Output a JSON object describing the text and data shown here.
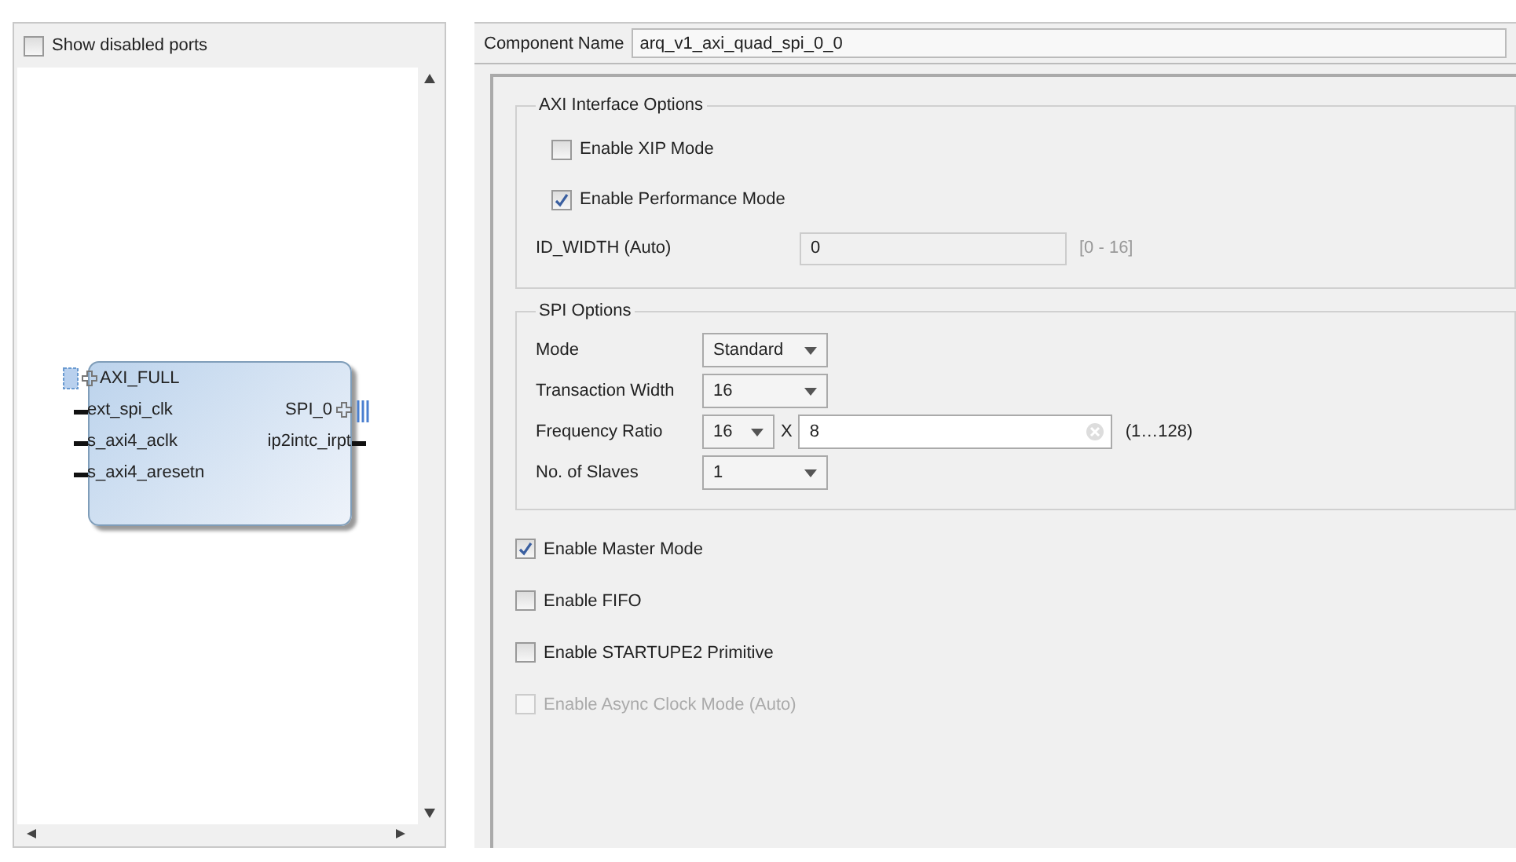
{
  "left_panel": {
    "show_disabled_ports": {
      "label": "Show disabled ports",
      "checked": false
    },
    "block": {
      "bus_port": "AXI_FULL",
      "left_ports": [
        "ext_spi_clk",
        "s_axi4_aclk",
        "s_axi4_aresetn"
      ],
      "right_ports": [
        {
          "label": "SPI_0",
          "kind": "bus"
        },
        {
          "label": "ip2intc_irpt",
          "kind": "wire"
        }
      ]
    }
  },
  "component_name": {
    "label": "Component Name",
    "value": "arq_v1_axi_quad_spi_0_0"
  },
  "axi_options": {
    "title": "AXI Interface Options",
    "checkboxes": [
      {
        "label": "Enable XIP Mode",
        "checked": false,
        "disabled": false
      },
      {
        "label": "Enable Performance Mode",
        "checked": true,
        "disabled": false
      }
    ],
    "id_width": {
      "label": "ID_WIDTH (Auto)",
      "value": "0",
      "range": "[0 - 16]",
      "disabled": true
    }
  },
  "spi_options": {
    "title": "SPI Options",
    "rows": [
      {
        "kind": "select",
        "label": "Mode",
        "value": "Standard"
      },
      {
        "kind": "select",
        "label": "Transaction Width",
        "value": "16"
      },
      {
        "kind": "ratio",
        "label": "Frequency Ratio",
        "value": "16",
        "multiplier": "X",
        "factor": "8",
        "range": "(1…128)"
      },
      {
        "kind": "select",
        "label": "No. of Slaves",
        "value": "1"
      }
    ]
  },
  "options": [
    {
      "label": "Enable Master Mode",
      "checked": true,
      "disabled": false
    },
    {
      "label": "Enable FIFO",
      "checked": false,
      "disabled": false
    },
    {
      "label": "Enable STARTUPE2 Primitive",
      "checked": false,
      "disabled": false
    },
    {
      "label": "Enable Async Clock Mode (Auto)",
      "checked": false,
      "disabled": true
    }
  ]
}
